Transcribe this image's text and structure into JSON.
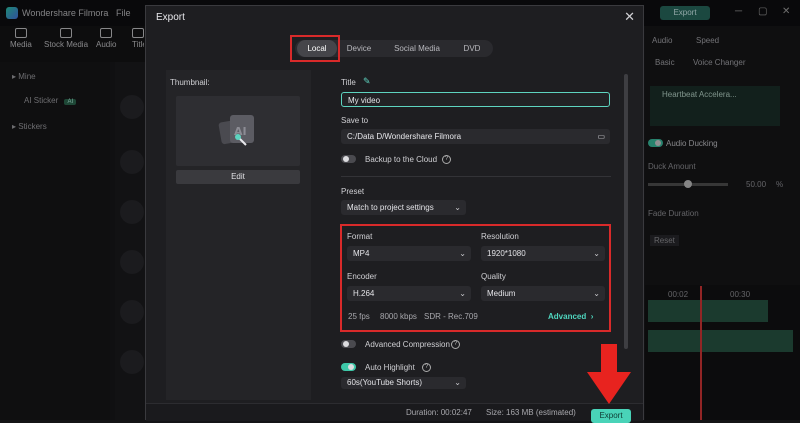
{
  "app": {
    "name": "Wondershare Filmora",
    "file_menu": "File",
    "export_label": "Export",
    "toolbar": [
      "Media",
      "Stock Media",
      "Audio",
      "Titles"
    ],
    "left_panel": {
      "mine": "Mine",
      "ai_sticker": "AI Sticker",
      "ai_badge": "AI",
      "stickers": "Stickers"
    },
    "right_panel": {
      "tabs": [
        "Audio",
        "Speed"
      ],
      "subtabs": [
        "Basic",
        "Voice Changer"
      ],
      "clip_name": "Heartbeat Accelera...",
      "audio_ducking": "Audio Ducking",
      "duck_amount": "Duck Amount",
      "duck_value": "50.00",
      "duck_unit": "%",
      "fade_duration": "Fade Duration",
      "reset": "Reset",
      "timecodes": [
        "00:02",
        "00:30"
      ]
    }
  },
  "dialog": {
    "title": "Export",
    "tabs": [
      {
        "label": "Local",
        "active": true
      },
      {
        "label": "Device",
        "active": false
      },
      {
        "label": "Social Media",
        "active": false
      },
      {
        "label": "DVD",
        "active": false
      }
    ],
    "thumbnail_label": "Thumbnail:",
    "edit_label": "Edit",
    "title_label": "Title",
    "title_value": "My video",
    "save_to_label": "Save to",
    "save_to_value": "C:/Data D/Wondershare Filmora",
    "backup_label": "Backup to the Cloud",
    "preset_label": "Preset",
    "preset_value": "Match to project settings",
    "format_label": "Format",
    "format_value": "MP4",
    "resolution_label": "Resolution",
    "resolution_value": "1920*1080",
    "encoder_label": "Encoder",
    "encoder_value": "H.264",
    "quality_label": "Quality",
    "quality_value": "Medium",
    "fps": "25 fps",
    "bitrate": "8000 kbps",
    "color": "SDR - Rec.709",
    "advanced_label": "Advanced",
    "advanced_compression_label": "Advanced Compression",
    "auto_highlight_label": "Auto Highlight",
    "auto_highlight_value": "60s(YouTube Shorts)",
    "duration_label": "Duration:",
    "duration_value": "00:02:47",
    "size_label": "Size:",
    "size_value": "163 MB (estimated)",
    "export_label": "Export"
  },
  "colors": {
    "accent": "#49d3b8",
    "highlight_box": "#d92a2a",
    "arrow": "#e8231f"
  }
}
